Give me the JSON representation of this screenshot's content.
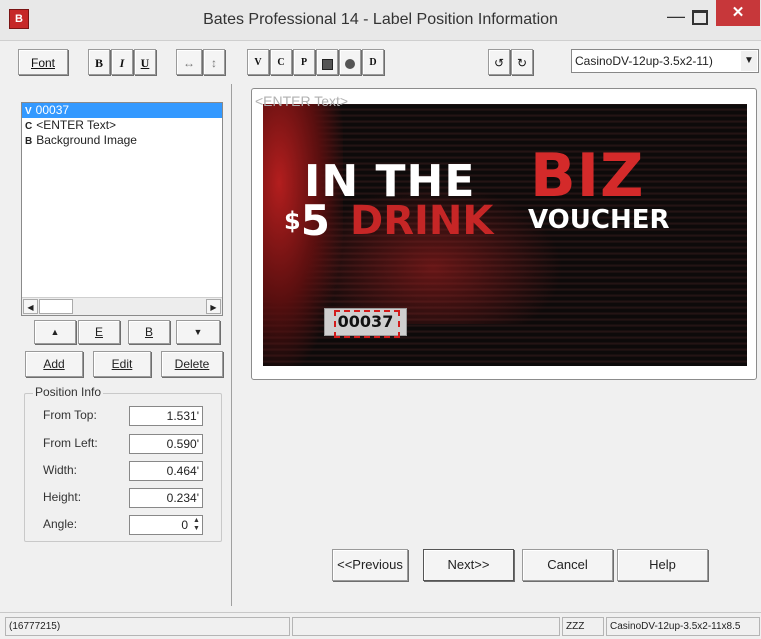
{
  "window": {
    "title": "Bates Professional 14 - Label Position Information",
    "minimize": "—",
    "close": "✕"
  },
  "toolbar": {
    "font_label": "Font",
    "bold": "B",
    "italic": "I",
    "underline": "U",
    "horizontal_size_icon": "↔",
    "vertical_size_icon": "↕",
    "v_label": "V",
    "c_label": "C",
    "p_label": "P",
    "rotate_ccw_icon": "↺",
    "rotate_cw_icon": "↻",
    "layout_combo_value": "CasinoDV-12up-3.5x2-11)",
    "combo_arrow": "▼"
  },
  "element_list": {
    "items": [
      {
        "code": "V",
        "label": "00037",
        "selected": true
      },
      {
        "code": "C",
        "label": "<ENTER Text>",
        "selected": false
      },
      {
        "code": "B",
        "label": "Background Image",
        "selected": false
      }
    ],
    "scroll_left": "◀",
    "scroll_right": "▶"
  },
  "list_controls": {
    "up": "▲",
    "e_label": "E",
    "b_label": "B",
    "down": "▼",
    "add": "Add",
    "edit": "Edit",
    "delete": "Delete"
  },
  "position_info": {
    "title": "Position Info",
    "fields": [
      {
        "label": "From Top:",
        "value": "1.531'"
      },
      {
        "label": "From Left:",
        "value": "0.590'"
      },
      {
        "label": "Width:",
        "value": "0.464'"
      },
      {
        "label": "Height:",
        "value": "0.234'"
      },
      {
        "label": "Angle:",
        "value": "0"
      }
    ]
  },
  "preview": {
    "enter_text": "<ENTER Text>",
    "line1": "IN THE",
    "biz": "BIZ",
    "dollar": "$",
    "five": "5",
    "drink": "DRINK",
    "voucher": "VOUCHER",
    "serial": "00037"
  },
  "navigation": {
    "previous": "<<Previous",
    "next": "Next>>",
    "cancel": "Cancel",
    "help": "Help"
  },
  "status": {
    "color_code": "(16777215)",
    "zzz": "ZZZ",
    "layout": "CasinoDV-12up-3.5x2-11x8.5"
  }
}
